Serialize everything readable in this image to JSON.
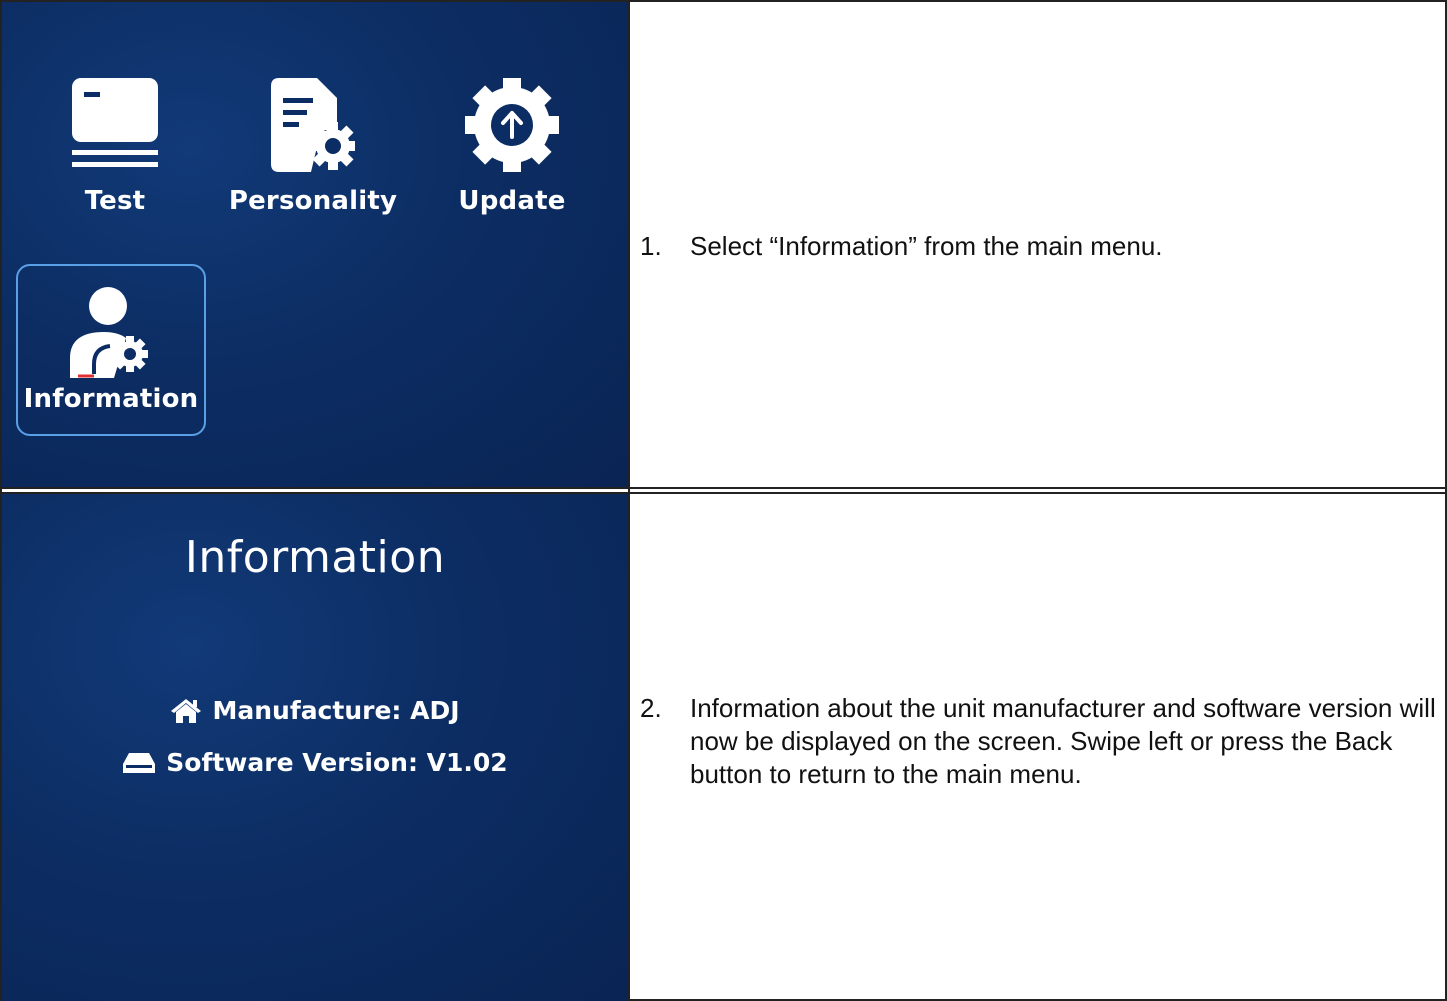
{
  "menu": {
    "items": [
      {
        "label": "Test",
        "icon": "test-card-icon"
      },
      {
        "label": "Personality",
        "icon": "personality-gear-icon"
      },
      {
        "label": "Update",
        "icon": "update-arrow-icon"
      },
      {
        "label": "Information",
        "icon": "information-user-gear-icon",
        "selected": true
      }
    ]
  },
  "info_screen": {
    "title": "Information",
    "manufacture": "Manufacture: ADJ",
    "software_version": "Software Version: V1.02"
  },
  "steps": [
    {
      "number": "1.",
      "text": "Select “Information” from the main menu."
    },
    {
      "number": "2.",
      "text": "Information about the unit manufacturer and software version will now be displayed on the screen. Swipe left or press the Back button to return to the main menu."
    }
  ],
  "colors": {
    "screen_bg": "#0c2d63",
    "selection_border": "#5aa0e6",
    "icon_white": "#ffffff"
  }
}
